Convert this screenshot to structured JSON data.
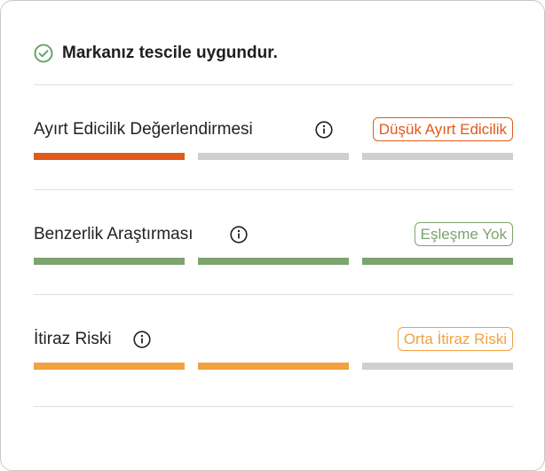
{
  "header": {
    "status_text": "Markanız tescile uygundur.",
    "icon": "check-circle-icon",
    "icon_color": "#6aa36a"
  },
  "rows": [
    {
      "label": "Ayırt Edicilik Değerlendirmesi",
      "badge": "Düşük Ayırt Edicilik",
      "badge_color": "#e05a1b",
      "filled_segments": 1,
      "total_segments": 3,
      "fill_color": "#e05a1b"
    },
    {
      "label": "Benzerlik Araştırması",
      "badge": "Eşleşme Yok",
      "badge_color": "#7ea36e",
      "filled_segments": 3,
      "total_segments": 3,
      "fill_color": "#7ea36e"
    },
    {
      "label": "İtiraz Riski",
      "badge": "Orta İtiraz Riski",
      "badge_color": "#f2a23f",
      "filled_segments": 2,
      "total_segments": 3,
      "fill_color": "#f2a23f"
    }
  ],
  "empty_segment_color": "#cfcfcf"
}
